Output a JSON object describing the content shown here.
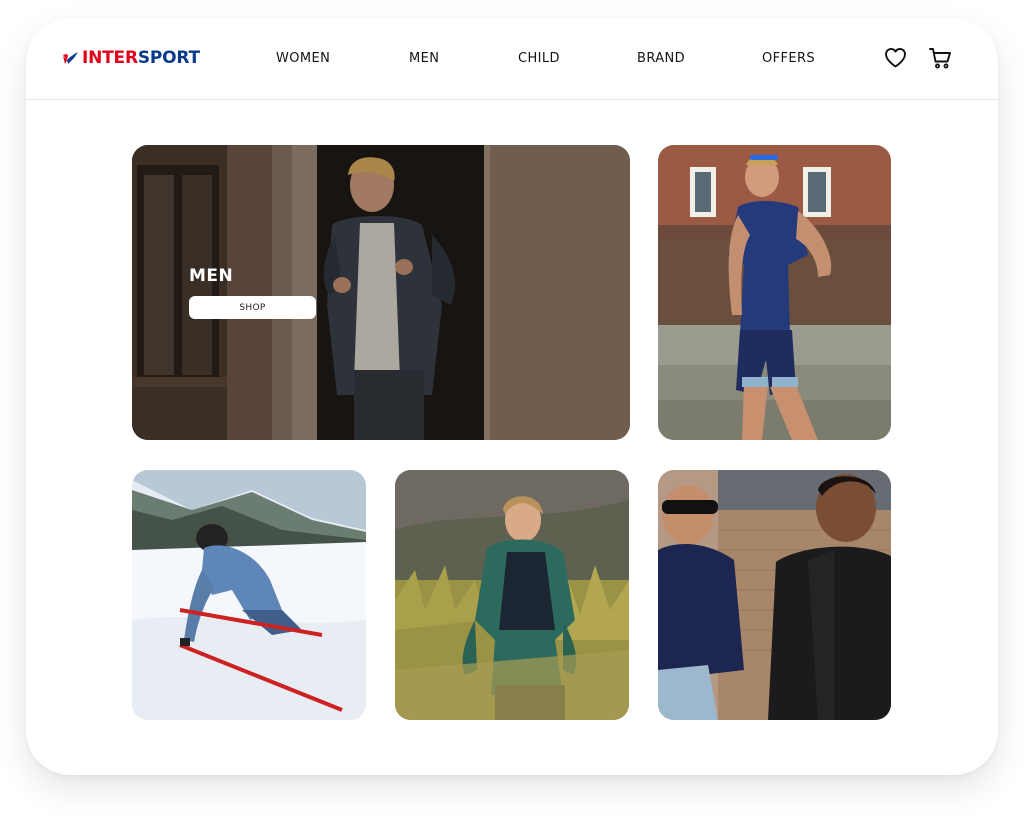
{
  "brand": {
    "name_part1": "INTER",
    "name_part2": "SPORT",
    "colors": {
      "red": "#e2001a",
      "blue": "#0a3a8c"
    }
  },
  "nav": {
    "items": [
      {
        "label": "WOMEN"
      },
      {
        "label": "MEN"
      },
      {
        "label": "CHILD"
      },
      {
        "label": "BRAND"
      },
      {
        "label": "OFFERS"
      }
    ],
    "icons": [
      "heart-icon",
      "cart-icon"
    ]
  },
  "hero": {
    "title": "MEN",
    "button_label": "SHOP"
  },
  "tiles": [
    {
      "subject": "man-in-doorway-jacket"
    },
    {
      "subject": "runner-blue-shirt"
    },
    {
      "subject": "skier-on-slope"
    },
    {
      "subject": "hiker-green-jacket"
    },
    {
      "subject": "two-runners"
    }
  ]
}
